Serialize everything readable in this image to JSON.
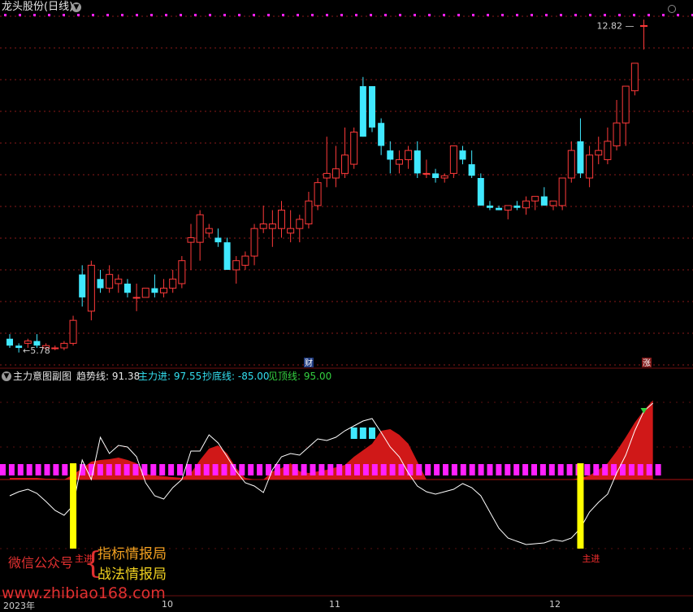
{
  "header": {
    "title": "龙头股份(日线)",
    "price_max_label": "12.82",
    "price_min_label": "5.78",
    "event_cai": "财",
    "event_zhang": "涨"
  },
  "indicator": {
    "name": "主力意图副图",
    "items": [
      {
        "label": "趋势线: 91.38",
        "color": "#e6e6e6"
      },
      {
        "label": "主力进: 97.55",
        "color": "#33e0f0"
      },
      {
        "label": "抄底线: -85.00",
        "color": "#33e0f0"
      },
      {
        "label": "见顶线: 95.00",
        "color": "#33d040"
      }
    ],
    "signal_label": "主进"
  },
  "watermark": {
    "left": "微信公众号",
    "brace": "{",
    "right1": "指标情报局",
    "right2": "战法情报局",
    "url": "www.zhibiao168.com"
  },
  "x_axis": [
    "2023年",
    "10",
    "11",
    "12"
  ],
  "colors": {
    "up": "#ff3a3a",
    "down": "#40e8ff",
    "grid": "#8a1a1a",
    "trend": "#ffffff",
    "fill": "#d01818",
    "magenta": "#ff20ff",
    "yellow": "#ffff00"
  },
  "chart_data": [
    {
      "type": "candlestick",
      "title": "龙头股份(日线)",
      "y_range": [
        5.5,
        13.2
      ],
      "annotations": {
        "max": 12.82,
        "min": 5.78
      },
      "ohlc": [
        [
          6.0,
          6.1,
          5.8,
          5.85
        ],
        [
          5.85,
          5.9,
          5.7,
          5.8
        ],
        [
          5.9,
          6.0,
          5.8,
          5.95
        ],
        [
          5.95,
          6.1,
          5.8,
          5.85
        ],
        [
          5.8,
          5.9,
          5.75,
          5.85
        ],
        [
          5.8,
          5.85,
          5.75,
          5.8
        ],
        [
          5.8,
          5.95,
          5.75,
          5.9
        ],
        [
          5.9,
          6.5,
          5.85,
          6.4
        ],
        [
          7.4,
          7.6,
          6.7,
          6.9
        ],
        [
          6.6,
          7.7,
          6.4,
          7.6
        ],
        [
          7.3,
          7.5,
          7.0,
          7.1
        ],
        [
          7.1,
          7.6,
          7.0,
          7.4
        ],
        [
          7.2,
          7.4,
          7.0,
          7.3
        ],
        [
          7.2,
          7.3,
          6.9,
          7.0
        ],
        [
          6.9,
          7.2,
          6.6,
          6.9
        ],
        [
          6.9,
          7.1,
          6.9,
          7.1
        ],
        [
          7.1,
          7.4,
          6.9,
          7.0
        ],
        [
          7.0,
          7.3,
          6.9,
          7.1
        ],
        [
          7.1,
          7.5,
          7.0,
          7.3
        ],
        [
          7.2,
          7.8,
          7.1,
          7.7
        ],
        [
          8.1,
          8.5,
          7.5,
          8.2
        ],
        [
          8.1,
          8.8,
          7.7,
          8.7
        ],
        [
          8.3,
          8.5,
          8.2,
          8.4
        ],
        [
          8.2,
          8.4,
          8.0,
          8.1
        ],
        [
          8.1,
          8.2,
          7.6,
          7.5
        ],
        [
          7.5,
          7.8,
          7.2,
          7.7
        ],
        [
          7.6,
          7.9,
          7.5,
          7.8
        ],
        [
          7.8,
          8.5,
          7.6,
          8.4
        ],
        [
          8.4,
          8.9,
          8.3,
          8.5
        ],
        [
          8.4,
          8.8,
          8.0,
          8.5
        ],
        [
          8.4,
          9.0,
          8.2,
          8.8
        ],
        [
          8.3,
          8.8,
          8.1,
          8.4
        ],
        [
          8.4,
          8.7,
          8.1,
          8.6
        ],
        [
          8.5,
          9.2,
          8.4,
          9.0
        ],
        [
          8.9,
          9.5,
          8.8,
          9.4
        ],
        [
          9.5,
          10.4,
          9.3,
          9.6
        ],
        [
          9.5,
          10.2,
          9.3,
          9.7
        ],
        [
          9.6,
          10.6,
          9.5,
          10.0
        ],
        [
          9.8,
          10.6,
          9.7,
          10.5
        ],
        [
          11.5,
          11.7,
          10.4,
          10.4
        ],
        [
          11.5,
          11.5,
          10.5,
          10.6
        ],
        [
          10.7,
          10.8,
          10.0,
          10.2
        ],
        [
          10.1,
          10.3,
          9.6,
          9.9
        ],
        [
          9.8,
          10.1,
          9.6,
          9.9
        ],
        [
          9.9,
          10.2,
          9.7,
          10.1
        ],
        [
          10.1,
          10.3,
          9.5,
          9.6
        ],
        [
          9.6,
          9.9,
          9.5,
          9.6
        ],
        [
          9.6,
          9.7,
          9.4,
          9.5
        ],
        [
          9.5,
          9.6,
          9.4,
          9.55
        ],
        [
          9.6,
          10.2,
          9.5,
          10.2
        ],
        [
          10.1,
          10.2,
          9.8,
          9.9
        ],
        [
          9.8,
          10.1,
          9.5,
          9.55
        ],
        [
          9.5,
          9.6,
          8.9,
          8.9
        ],
        [
          8.9,
          9.0,
          8.8,
          8.85
        ],
        [
          8.85,
          8.9,
          8.8,
          8.8
        ],
        [
          8.8,
          8.9,
          8.6,
          8.9
        ],
        [
          8.9,
          9.0,
          8.8,
          8.85
        ],
        [
          8.85,
          9.1,
          8.7,
          9.0
        ],
        [
          9.0,
          9.1,
          8.8,
          9.1
        ],
        [
          9.1,
          9.3,
          8.9,
          8.9
        ],
        [
          8.9,
          9.0,
          8.8,
          9.0
        ],
        [
          8.9,
          9.5,
          8.8,
          9.5
        ],
        [
          9.5,
          10.3,
          9.4,
          10.1
        ],
        [
          10.3,
          10.8,
          9.5,
          9.6
        ],
        [
          9.5,
          10.2,
          9.3,
          10.0
        ],
        [
          10.0,
          10.4,
          9.8,
          10.1
        ],
        [
          9.9,
          10.6,
          9.8,
          10.3
        ],
        [
          10.2,
          11.2,
          10.1,
          10.7
        ],
        [
          10.7,
          11.4,
          10.2,
          11.5
        ],
        [
          11.4,
          12.0,
          11.3,
          12.0
        ],
        [
          12.82,
          12.95,
          12.3,
          12.82
        ]
      ]
    },
    {
      "type": "area",
      "title": "主力意图副图",
      "y_range": [
        -100,
        120
      ],
      "reference_lines": {
        "抄底线": -85.0,
        "见顶线": 95.0
      },
      "series": [
        {
          "name": "趋势线",
          "last": 91.38,
          "values": [
            -20,
            -15,
            -12,
            -17,
            -27,
            -38,
            -44,
            -32,
            24,
            0,
            52,
            32,
            42,
            40,
            28,
            -4,
            -20,
            -24,
            -10,
            0,
            35,
            35,
            55,
            45,
            28,
            10,
            -4,
            -8,
            -16,
            12,
            28,
            32,
            30,
            40,
            50,
            48,
            52,
            60,
            66,
            72,
            75,
            58,
            40,
            28,
            8,
            -8,
            -15,
            -18,
            -15,
            -12,
            -5,
            -10,
            -20,
            -40,
            -60,
            -72,
            -76,
            -80,
            -79,
            -78,
            -74,
            -76,
            -72,
            -60,
            -40,
            -28,
            -18,
            8,
            30,
            60,
            84,
            94
          ]
        },
        {
          "name": "主力进",
          "last": 97.55,
          "values": [
            2,
            2,
            2,
            2,
            1,
            1,
            0,
            6,
            14,
            22,
            24,
            25,
            27,
            24,
            20,
            7,
            5,
            4,
            3,
            2,
            8,
            24,
            38,
            42,
            32,
            14,
            2,
            0,
            0,
            10,
            14,
            20,
            10,
            8,
            10,
            12,
            15,
            18,
            28,
            36,
            44,
            60,
            62,
            55,
            44,
            22,
            0,
            0,
            0,
            0,
            0,
            0,
            0,
            0,
            0,
            0,
            0,
            0,
            0,
            0,
            0,
            0,
            0,
            2,
            5,
            12,
            20,
            35,
            52,
            70,
            85,
            97.55
          ]
        },
        {
          "name": "抄底线",
          "value": -85.0
        },
        {
          "name": "见顶线",
          "value": 95.0
        }
      ],
      "signals": [
        {
          "label": "主进",
          "index": 7,
          "type": "buy"
        },
        {
          "label": "主进",
          "index": 63,
          "type": "buy"
        }
      ],
      "highlight_range": [
        38,
        40
      ]
    }
  ]
}
